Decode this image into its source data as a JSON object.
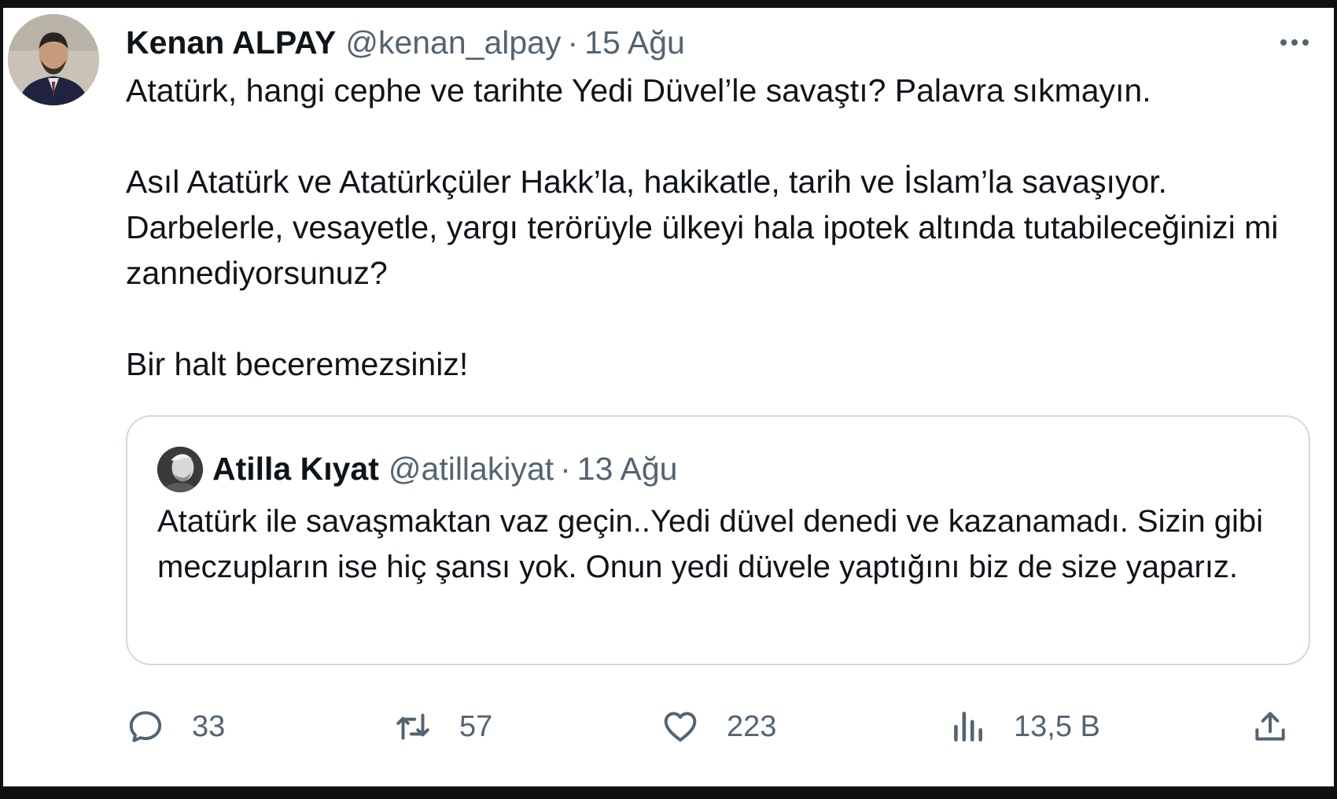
{
  "tweet": {
    "author_name": "Kenan ALPAY",
    "author_handle": "@kenan_alpay",
    "separator": "·",
    "date": "15 Ağu",
    "paragraphs": [
      "Atatürk, hangi cephe ve tarihte Yedi Düvel’le savaştı? Palavra sıkmayın.",
      "Asıl Atatürk ve Atatürkçüler Hakk’la, hakikatle, tarih ve İslam’la savaşıyor. Darbelerle, vesayetle, yargı terörüyle ülkeyi hala ipotek altında tutabileceğinizi mi zannediyorsunuz?",
      "Bir halt beceremezsiniz!"
    ]
  },
  "quoted_tweet": {
    "author_name": "Atilla Kıyat",
    "author_handle": "@atillakiyat",
    "separator": "·",
    "date": "13 Ağu",
    "text": "Atatürk ile savaşmaktan vaz geçin..Yedi düvel denedi ve kazanamadı. Sizin gibi meczupların ise hiç şansı yok. Onun yedi düvele yaptığını biz de size yaparız."
  },
  "actions": {
    "reply_count": "33",
    "retweet_count": "57",
    "like_count": "223",
    "views_count": "13,5 B"
  },
  "icons": {
    "more": "more-horizontal-icon",
    "reply": "reply-icon",
    "retweet": "retweet-icon",
    "like": "heart-icon",
    "views": "views-chart-icon",
    "share": "share-icon"
  },
  "colors": {
    "text_primary": "#0f1419",
    "text_secondary": "#536471",
    "border": "#cfd9de",
    "background": "#ffffff",
    "outer_frame": "#111111"
  }
}
